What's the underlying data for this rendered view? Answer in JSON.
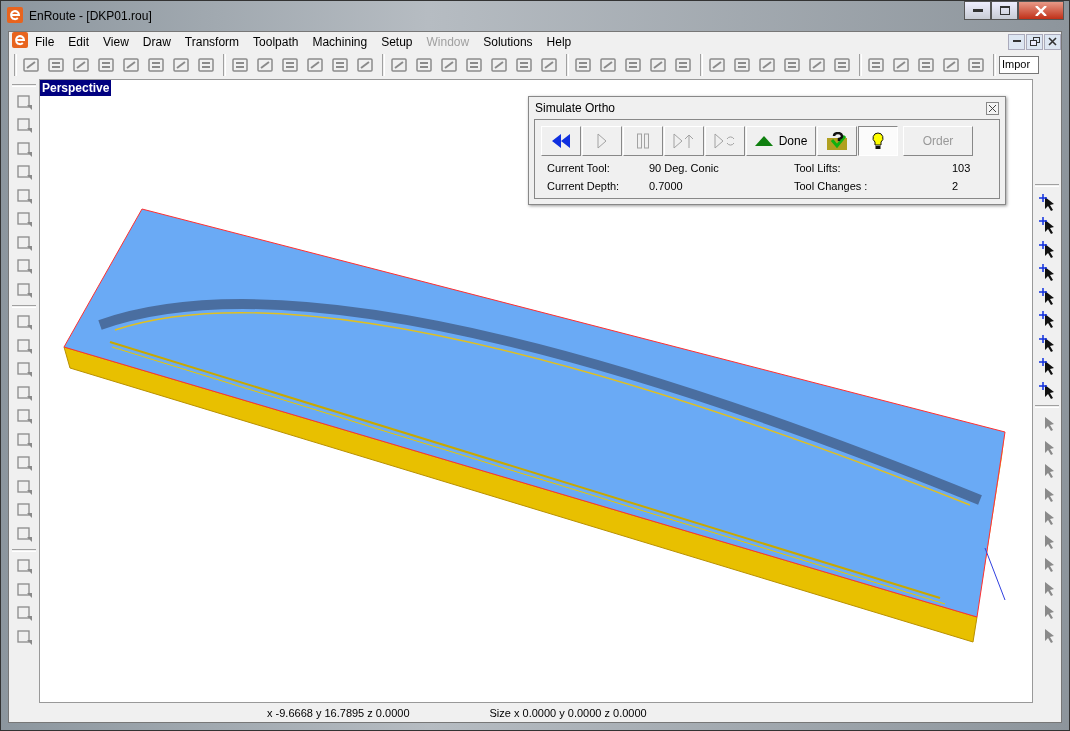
{
  "window": {
    "title": "EnRoute - [DKP01.rou]"
  },
  "menu": [
    {
      "label": "File",
      "disabled": false
    },
    {
      "label": "Edit",
      "disabled": false
    },
    {
      "label": "View",
      "disabled": false
    },
    {
      "label": "Draw",
      "disabled": false
    },
    {
      "label": "Transform",
      "disabled": false
    },
    {
      "label": "Toolpath",
      "disabled": false
    },
    {
      "label": "Machining",
      "disabled": false
    },
    {
      "label": "Setup",
      "disabled": false
    },
    {
      "label": "Window",
      "disabled": true
    },
    {
      "label": "Solutions",
      "disabled": false
    },
    {
      "label": "Help",
      "disabled": false
    }
  ],
  "toolbar": {
    "field_value": "Impor"
  },
  "viewport": {
    "label": "Perspective"
  },
  "simulate_dialog": {
    "title": "Simulate Ortho",
    "buttons": [
      {
        "kind": "rewind",
        "disabled": false,
        "pressed": false
      },
      {
        "kind": "play",
        "disabled": true,
        "pressed": false
      },
      {
        "kind": "pause",
        "disabled": true,
        "pressed": false
      },
      {
        "kind": "step",
        "disabled": true,
        "pressed": false
      },
      {
        "kind": "loop",
        "disabled": true,
        "pressed": false
      },
      {
        "kind": "done",
        "label": "Done",
        "disabled": false,
        "pressed": false
      },
      {
        "kind": "help",
        "disabled": false,
        "pressed": false
      },
      {
        "kind": "light",
        "disabled": false,
        "pressed": true
      },
      {
        "kind": "order",
        "label": "Order",
        "disabled": true,
        "pressed": false
      }
    ],
    "stats": [
      {
        "label": "Current Tool:",
        "value": "90 Deg. Conic"
      },
      {
        "label": "Tool Lifts:",
        "value": "103"
      },
      {
        "label": "Current Depth:",
        "value": "0.7000"
      },
      {
        "label": "Tool Changes :",
        "value": "2"
      }
    ]
  },
  "status_bar": {
    "position": "x -9.6668 y 16.7895 z 0.0000",
    "size": "Size x 0.0000 y 0.0000 z 0.0000"
  }
}
